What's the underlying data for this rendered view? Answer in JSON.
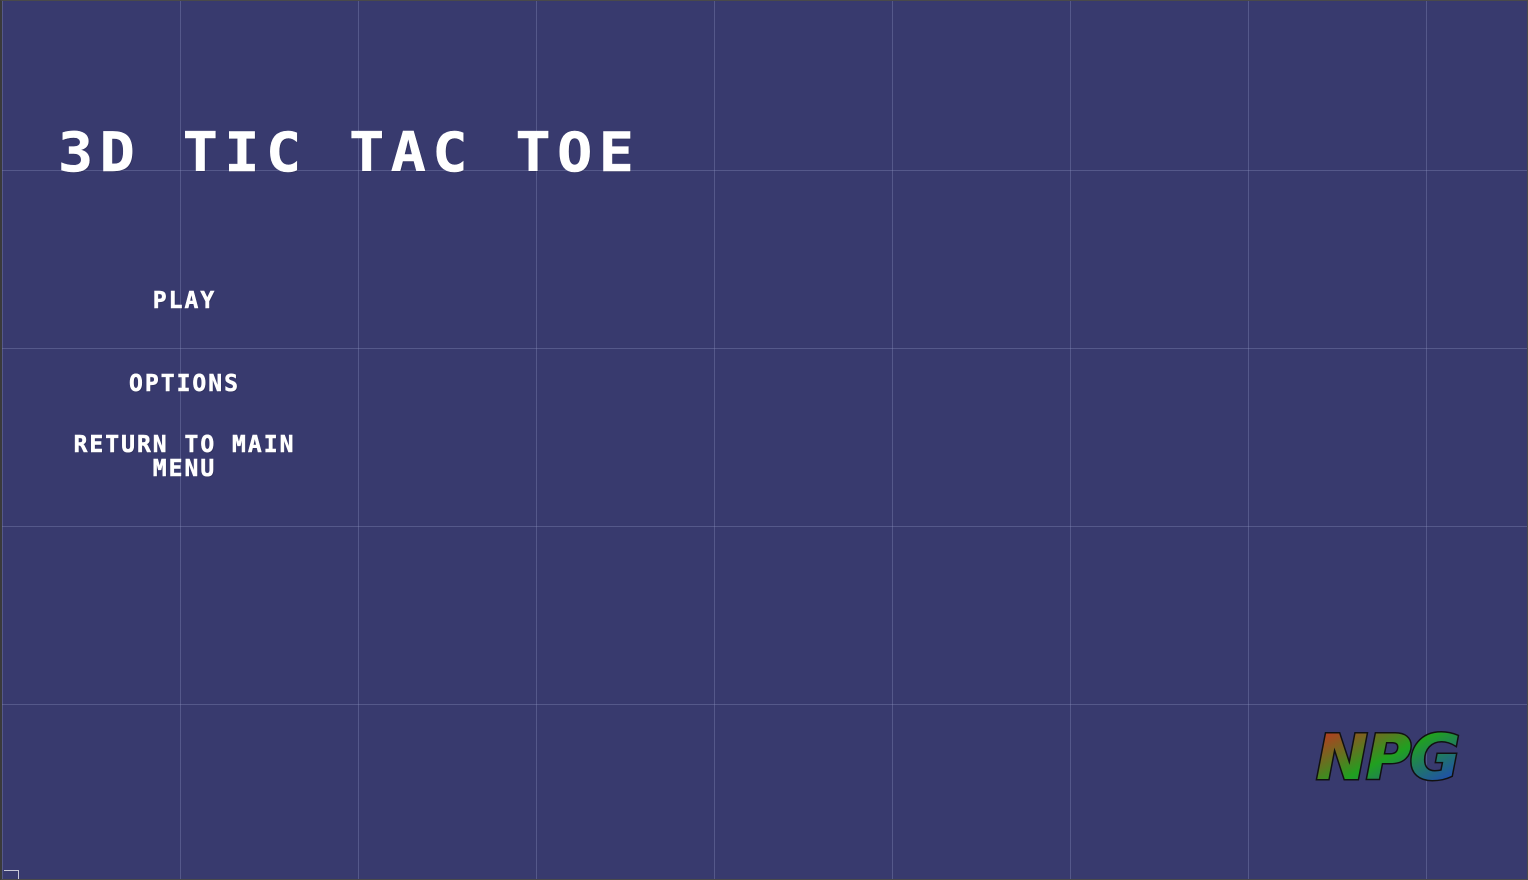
{
  "game": {
    "title": "3D TIC TAC TOE"
  },
  "menu": {
    "play_label": "PLAY",
    "options_label": "OPTIONS",
    "return_label": "RETURN TO MAIN MENU"
  },
  "logo": {
    "text": "NPG",
    "colors": [
      "#e02020",
      "#20a020",
      "#2030e0"
    ]
  },
  "colors": {
    "background": "#383a6e",
    "grid": "#6a6ea0",
    "text": "#ffffff"
  }
}
